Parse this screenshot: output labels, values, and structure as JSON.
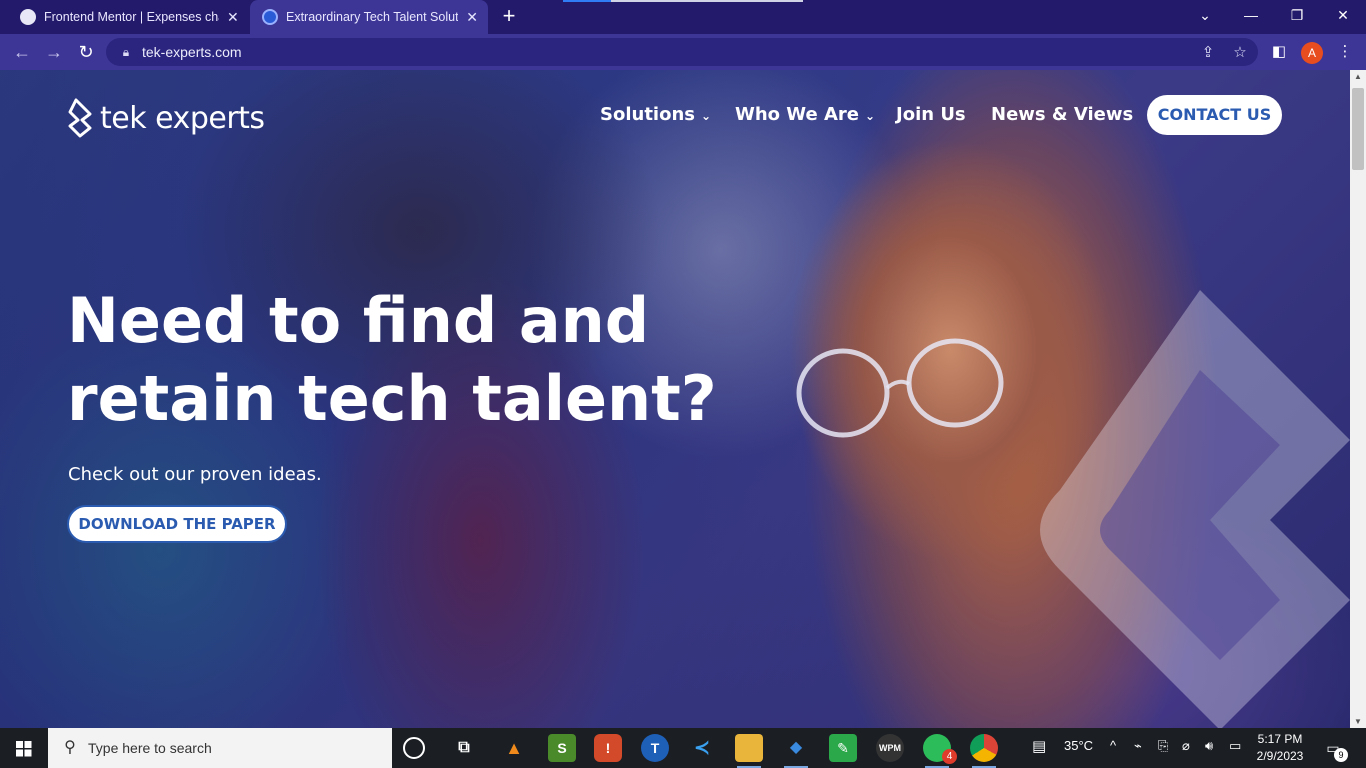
{
  "browser": {
    "tabs": [
      {
        "title": "Frontend Mentor | Expenses char",
        "close": "✕"
      },
      {
        "title": "Extraordinary Tech Talent Solution",
        "close": "✕"
      }
    ],
    "new_tab": "+",
    "loading_progress": 0.2,
    "url": "tek-experts.com",
    "profile_initial": "A",
    "window": {
      "minimize": "—",
      "restore": "❐",
      "close": "✕",
      "tabs_menu": "⌄"
    }
  },
  "site": {
    "logo_text": "tek experts",
    "nav": [
      {
        "label": "Solutions",
        "dropdown": true
      },
      {
        "label": "Who We Are",
        "dropdown": true
      },
      {
        "label": "Join Us",
        "dropdown": false
      },
      {
        "label": "News & Views",
        "dropdown": false
      }
    ],
    "contact_label": "CONTACT US",
    "headline_line1": "Need to find and",
    "headline_line2": "retain tech talent?",
    "subline": "Check out our proven ideas.",
    "download_label": "DOWNLOAD THE PAPER",
    "accent_color": "#2a5bb0"
  },
  "taskbar": {
    "search_placeholder": "Type here to search",
    "apps": [
      {
        "icon": "cortana-icon"
      },
      {
        "icon": "task-view-icon"
      },
      {
        "icon": "vlc-icon"
      },
      {
        "icon": "sublime-icon"
      },
      {
        "icon": "app-red-icon"
      },
      {
        "icon": "teamviewer-icon"
      },
      {
        "icon": "vscode-icon"
      },
      {
        "icon": "file-explorer-icon"
      },
      {
        "icon": "app-blue-icon"
      },
      {
        "icon": "notepad-icon"
      },
      {
        "icon": "wpm-icon"
      },
      {
        "icon": "whatsapp-icon",
        "badge": "4"
      },
      {
        "icon": "chrome-icon"
      }
    ],
    "weather": "35°C",
    "time": "5:17 PM",
    "date": "2/9/2023",
    "notifications": "9"
  }
}
